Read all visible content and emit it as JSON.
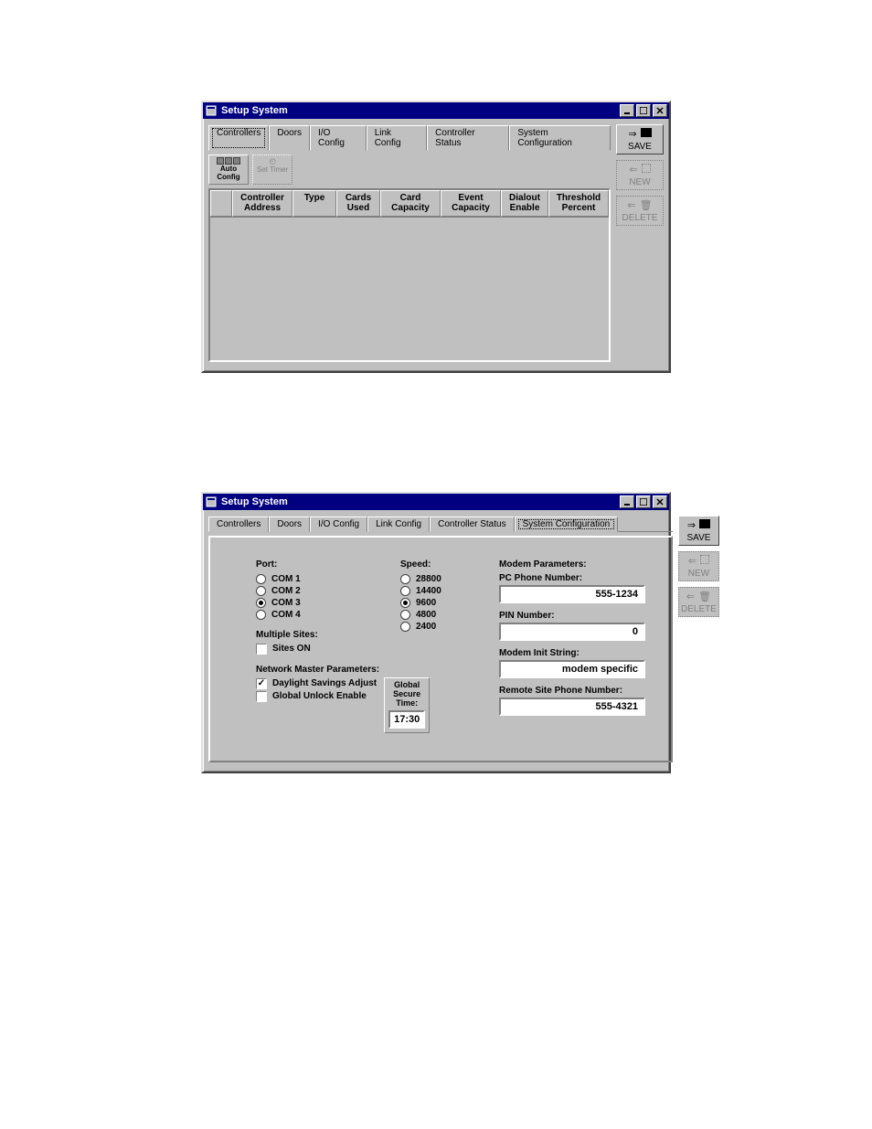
{
  "window1": {
    "title": "Setup System",
    "tabs": [
      "Controllers",
      "Doors",
      "I/O Config",
      "Link Config",
      "Controller Status",
      "System Configuration"
    ],
    "active_tab_index": 0,
    "toolbar": {
      "auto_config": "Auto\nConfig",
      "set_timer": "Set Timer"
    },
    "columns": [
      "",
      "Controller\nAddress",
      "Type",
      "Cards\nUsed",
      "Card\nCapacity",
      "Event\nCapacity",
      "Dialout\nEnable",
      "Threshold\nPercent"
    ],
    "buttons": {
      "save": "SAVE",
      "new": "NEW",
      "delete": "DELETE"
    }
  },
  "window2": {
    "title": "Setup System",
    "tabs": [
      "Controllers",
      "Doors",
      "I/O Config",
      "Link Config",
      "Controller Status",
      "System Configuration"
    ],
    "active_tab_index": 5,
    "port": {
      "label": "Port:",
      "options": [
        "COM 1",
        "COM 2",
        "COM 3",
        "COM 4"
      ],
      "selected_index": 2
    },
    "speed": {
      "label": "Speed:",
      "options": [
        "28800",
        "14400",
        "9600",
        "4800",
        "2400"
      ],
      "selected_index": 2
    },
    "multiple_sites": {
      "label": "Multiple Sites:",
      "option": "Sites ON",
      "checked": false
    },
    "network_master": {
      "label": "Network Master Parameters:",
      "daylight": {
        "label": "Daylight Savings Adjust",
        "checked": true
      },
      "global_unlock": {
        "label": "Global Unlock Enable",
        "checked": false
      },
      "global_secure": {
        "label": "Global Secure\nTime:",
        "value": "17:30"
      }
    },
    "modem": {
      "heading": "Modem Parameters:",
      "pc_phone": {
        "label": "PC Phone Number:",
        "value": "555-1234"
      },
      "pin": {
        "label": "PIN Number:",
        "value": "0"
      },
      "init_string": {
        "label": "Modem Init String:",
        "value": "modem specific"
      },
      "remote_phone": {
        "label": "Remote Site Phone Number:",
        "value": "555-4321"
      }
    },
    "buttons": {
      "save": "SAVE",
      "new": "NEW",
      "delete": "DELETE"
    }
  }
}
